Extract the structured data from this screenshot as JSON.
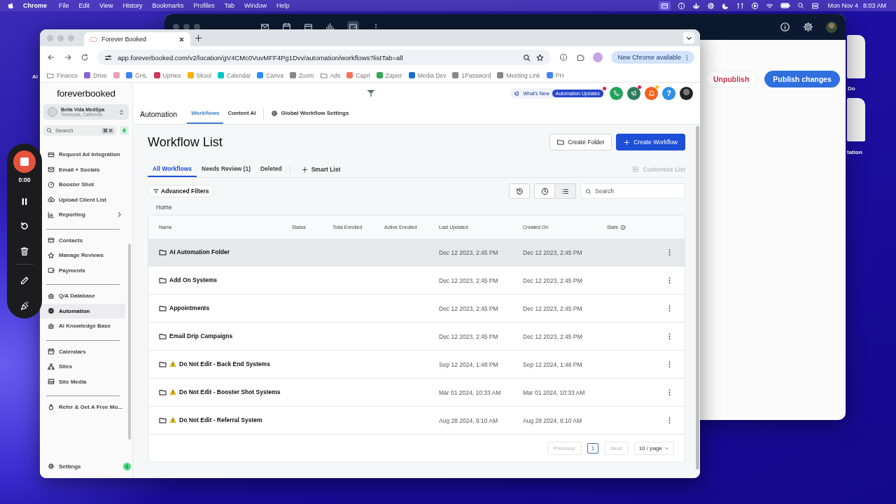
{
  "menubar": {
    "app": "Chrome",
    "menus": [
      "File",
      "Edit",
      "View",
      "History",
      "Bookmarks",
      "Profiles",
      "Tab",
      "Window",
      "Help"
    ],
    "date": "Mon Nov 4",
    "time": "8:03 AM"
  },
  "desktop_labels": [
    {
      "text": "Al"
    },
    {
      "text": "Do"
    },
    {
      "text": "tation"
    }
  ],
  "back_window": {
    "buttons": [
      {
        "label": "Unpublish",
        "kind": "secondary"
      },
      {
        "label": "Publish changes",
        "kind": "primary"
      }
    ]
  },
  "recorder": {
    "time": "0:00"
  },
  "browser": {
    "tab": {
      "title": "Forever Booked"
    },
    "url": "app.foreverbooked.com/v2/location/gV4CMc0VuvMFF4Pg1Dvv/automation/workflows?listTab=all",
    "update_chip": "New Chrome available",
    "bookmarks": [
      {
        "label": "Finance",
        "kind": "folder"
      },
      {
        "label": "Drive",
        "kind": "site"
      },
      {
        "kind": "site"
      },
      {
        "label": "GHL",
        "kind": "site"
      },
      {
        "label": "UpHex",
        "kind": "site"
      },
      {
        "label": "Skool",
        "kind": "site"
      },
      {
        "label": "Calendar",
        "kind": "site"
      },
      {
        "label": "Canva",
        "kind": "site"
      },
      {
        "label": "Zoom",
        "kind": "site"
      },
      {
        "label": "Ads",
        "kind": "folder"
      },
      {
        "label": "Capri",
        "kind": "site"
      },
      {
        "label": "Zapier",
        "kind": "site"
      },
      {
        "label": "Media Dev",
        "kind": "site"
      },
      {
        "label": "1Password",
        "kind": "site"
      },
      {
        "label": "Meeting Link",
        "kind": "site"
      },
      {
        "label": "PH",
        "kind": "site"
      }
    ]
  },
  "sidebar": {
    "logo": "foreverbooked",
    "account": {
      "name": "Bella Vida MedSpa",
      "location": "Temecula, California"
    },
    "search": {
      "placeholder": "Search",
      "shortcut": "⌘ K"
    },
    "groups": [
      {
        "items": [
          {
            "label": "Request Ad Integration",
            "selected": false,
            "submenu": false
          },
          {
            "label": "Email + Socials",
            "selected": false,
            "submenu": false
          },
          {
            "label": "Booster Shot",
            "selected": false,
            "submenu": false
          },
          {
            "label": "Upload Client List",
            "selected": false,
            "submenu": false
          },
          {
            "label": "Reporting",
            "selected": false,
            "submenu": true
          }
        ]
      },
      {
        "items": [
          {
            "label": "Contacts",
            "selected": false,
            "submenu": false
          },
          {
            "label": "Manage Reviews",
            "selected": false,
            "submenu": false
          },
          {
            "label": "Payments",
            "selected": false,
            "submenu": false
          }
        ]
      },
      {
        "items": [
          {
            "label": "Q/A Database",
            "selected": false,
            "submenu": false
          },
          {
            "label": "Automation",
            "selected": true,
            "submenu": false
          },
          {
            "label": "AI Knowledge Base",
            "selected": false,
            "submenu": false
          }
        ]
      },
      {
        "items": [
          {
            "label": "Calendars",
            "selected": false,
            "submenu": false
          },
          {
            "label": "Sites",
            "selected": false,
            "submenu": false
          },
          {
            "label": "Site Media",
            "selected": false,
            "submenu": false
          }
        ]
      },
      {
        "items": [
          {
            "label": "Refer & Get A Free Mo...",
            "selected": false,
            "submenu": false
          }
        ]
      }
    ],
    "settings": "Settings"
  },
  "header": {
    "title": "Automation",
    "tabs": [
      {
        "label": "Workflows",
        "selected": true,
        "kind": "tab"
      },
      {
        "label": "Content AI",
        "selected": false,
        "kind": "tab"
      },
      {
        "label": "Global Workflow Settings",
        "selected": false,
        "kind": "settings"
      }
    ],
    "whats_new": "What's New",
    "updates_badge": "Automation Updates",
    "help_glyph": "?"
  },
  "page": {
    "title": "Workflow List",
    "create_folder": "Create Folder",
    "create_workflow": "Create Workflow",
    "list_tabs": [
      {
        "label": "All Workflows",
        "selected": true
      },
      {
        "label": "Needs Review (1)",
        "selected": false
      },
      {
        "label": "Deleted",
        "selected": false
      }
    ],
    "smart_list": "Smart List",
    "customize": {
      "label": "Customize List",
      "disabled": true
    },
    "advanced_filters": "Advanced Filters",
    "search": {
      "placeholder": "Search"
    },
    "breadcrumb": "Home"
  },
  "table": {
    "columns": [
      "Name",
      "Status",
      "Total Enrolled",
      "Active Enrolled",
      "Last Updated",
      "Created On",
      "Stats"
    ],
    "rows": [
      {
        "name": "AI Automation Folder",
        "warning": false,
        "highlighted": true,
        "last_updated": "Dec 12 2023, 2:45 PM",
        "created_on": "Dec 12 2023, 2:45 PM"
      },
      {
        "name": "Add On Systems",
        "warning": false,
        "highlighted": false,
        "last_updated": "Dec 12 2023, 2:45 PM",
        "created_on": "Dec 12 2023, 2:45 PM"
      },
      {
        "name": "Appointments",
        "warning": false,
        "highlighted": false,
        "last_updated": "Dec 12 2023, 2:45 PM",
        "created_on": "Dec 12 2023, 2:45 PM"
      },
      {
        "name": "Email Drip Campaigns",
        "warning": false,
        "highlighted": false,
        "last_updated": "Dec 12 2023, 2:45 PM",
        "created_on": "Dec 12 2023, 2:45 PM"
      },
      {
        "name": "Do Not Edit - Back End Systems",
        "warning": true,
        "highlighted": false,
        "last_updated": "Sep 12 2024, 1:48 PM",
        "created_on": "Sep 12 2024, 1:48 PM"
      },
      {
        "name": "Do Not Edit - Booster Shot Systems",
        "warning": true,
        "highlighted": false,
        "last_updated": "Mar 01 2024, 10:33 AM",
        "created_on": "Mar 01 2024, 10:33 AM"
      },
      {
        "name": "Do Not Edit - Referral System",
        "warning": true,
        "highlighted": false,
        "last_updated": "Aug 28 2024, 6:10 AM",
        "created_on": "Aug 28 2024, 6:10 AM"
      }
    ]
  },
  "pagination": {
    "previous": {
      "label": "Previous",
      "disabled": true
    },
    "pages": [
      {
        "label": "1",
        "selected": true
      }
    ],
    "next": {
      "label": "Next",
      "disabled": true
    },
    "page_size": "10 / page"
  }
}
